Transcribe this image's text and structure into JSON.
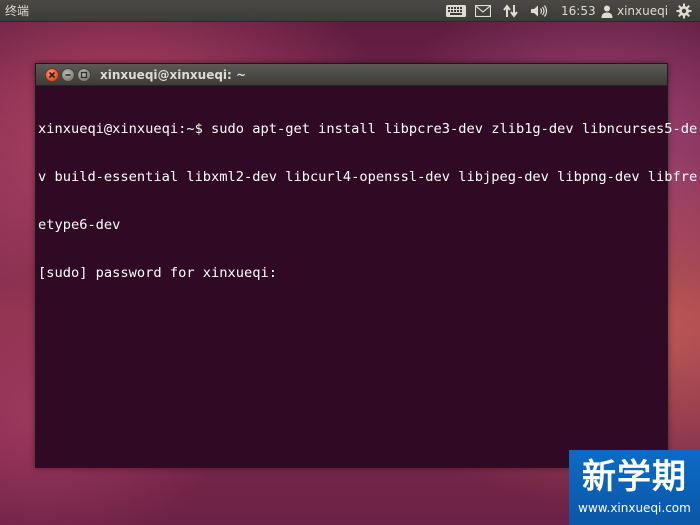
{
  "top_panel": {
    "app_title": "终端",
    "clock": "16:53",
    "user": "xinxueqi",
    "indicators": [
      "keyboard-icon",
      "mail-icon",
      "network-icon",
      "volume-icon",
      "user-icon",
      "gear-icon"
    ]
  },
  "terminal": {
    "title": "xinxueqi@xinxueqi: ~",
    "lines": [
      "xinxueqi@xinxueqi:~$ sudo apt-get install libpcre3-dev zlib1g-dev libncurses5-de",
      "v build-essential libxml2-dev libcurl4-openssl-dev libjpeg-dev libpng-dev libfre",
      "etype6-dev",
      "[sudo] password for xinxueqi:"
    ],
    "colors": {
      "background": "#300a24",
      "text": "#ffffff"
    }
  },
  "watermark": {
    "title": "新学期",
    "url": "www.xinxueqi.com",
    "color": "#0d6bc4"
  }
}
